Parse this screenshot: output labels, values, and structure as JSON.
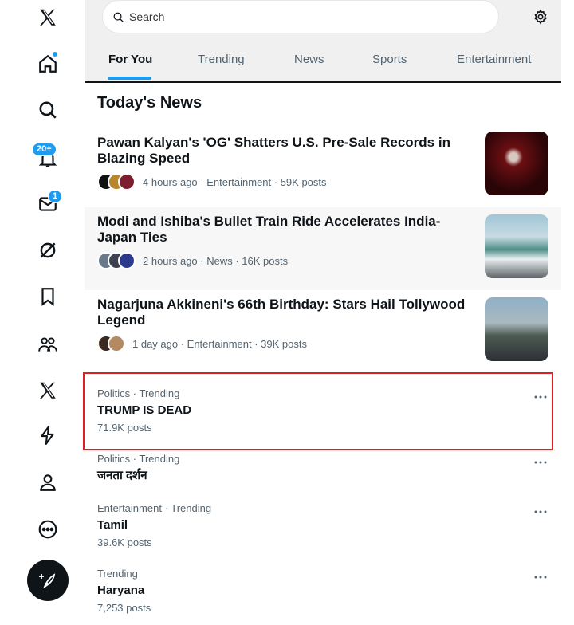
{
  "sidebar": {
    "items": [
      {
        "icon": "x-logo-icon"
      },
      {
        "icon": "home-icon",
        "has_dot": true
      },
      {
        "icon": "explore-icon"
      },
      {
        "icon": "notifications-icon",
        "badge": "20+"
      },
      {
        "icon": "messages-icon",
        "badge": "1"
      },
      {
        "icon": "grok-icon"
      },
      {
        "icon": "bookmarks-icon"
      },
      {
        "icon": "communities-icon"
      },
      {
        "icon": "premium-x-icon"
      },
      {
        "icon": "verified-orgs-icon"
      },
      {
        "icon": "profile-icon"
      },
      {
        "icon": "more-icon"
      }
    ],
    "compose_icon": "compose-post-icon"
  },
  "search": {
    "placeholder": "Search"
  },
  "tabs": [
    {
      "label": "For You",
      "active": true
    },
    {
      "label": "Trending"
    },
    {
      "label": "News"
    },
    {
      "label": "Sports"
    },
    {
      "label": "Entertainment"
    }
  ],
  "section_title": "Today's News",
  "news": [
    {
      "headline": "Pawan Kalyan's 'OG' Shatters U.S. Pre-Sale Records in Blazing Speed",
      "meta": "4 hours ago · Entertainment · 59K posts"
    },
    {
      "headline": "Modi and Ishiba's Bullet Train Ride Accelerates India-Japan Ties",
      "meta": "2 hours ago · News · 16K posts"
    },
    {
      "headline": "Nagarjuna Akkineni's 66th Birthday: Stars Hail Tollywood Legend",
      "meta": "1 day ago · Entertainment · 39K posts"
    }
  ],
  "trends": [
    {
      "category": "Politics · Trending",
      "name": "TRUMP IS DEAD",
      "count": "71.9K posts"
    },
    {
      "category": "Politics · Trending",
      "name": "जनता दर्शन",
      "count": ""
    },
    {
      "category": "Entertainment · Trending",
      "name": "Tamil",
      "count": "39.6K posts"
    },
    {
      "category": "Trending",
      "name": "Haryana",
      "count": "7,253 posts"
    }
  ],
  "colors": {
    "accent": "#1d9bf0",
    "highlight_border": "#e02020",
    "text_primary": "#0f1419",
    "text_secondary": "#536471"
  }
}
